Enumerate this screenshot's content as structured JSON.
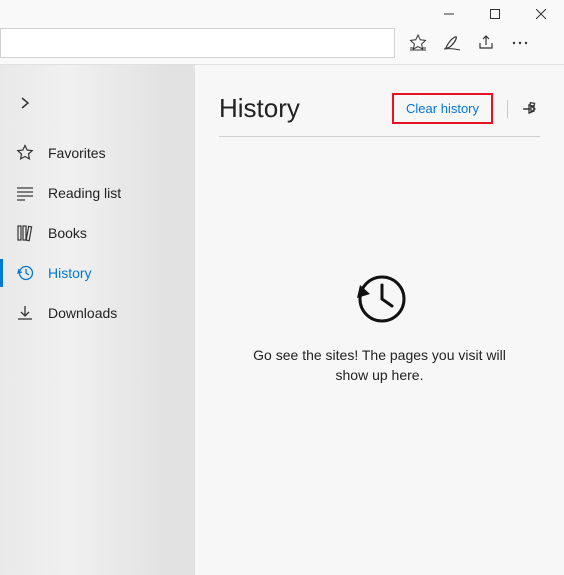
{
  "titlebar": {
    "minimize": "—",
    "maximize": "☐",
    "close": "✕"
  },
  "toolbar": {
    "url_value": ""
  },
  "sidebar": {
    "items": [
      {
        "label": "Favorites"
      },
      {
        "label": "Reading list"
      },
      {
        "label": "Books"
      },
      {
        "label": "History"
      },
      {
        "label": "Downloads"
      }
    ]
  },
  "main": {
    "title": "History",
    "clear_label": "Clear history",
    "empty_message": "Go see the sites! The pages you visit will show up here."
  }
}
